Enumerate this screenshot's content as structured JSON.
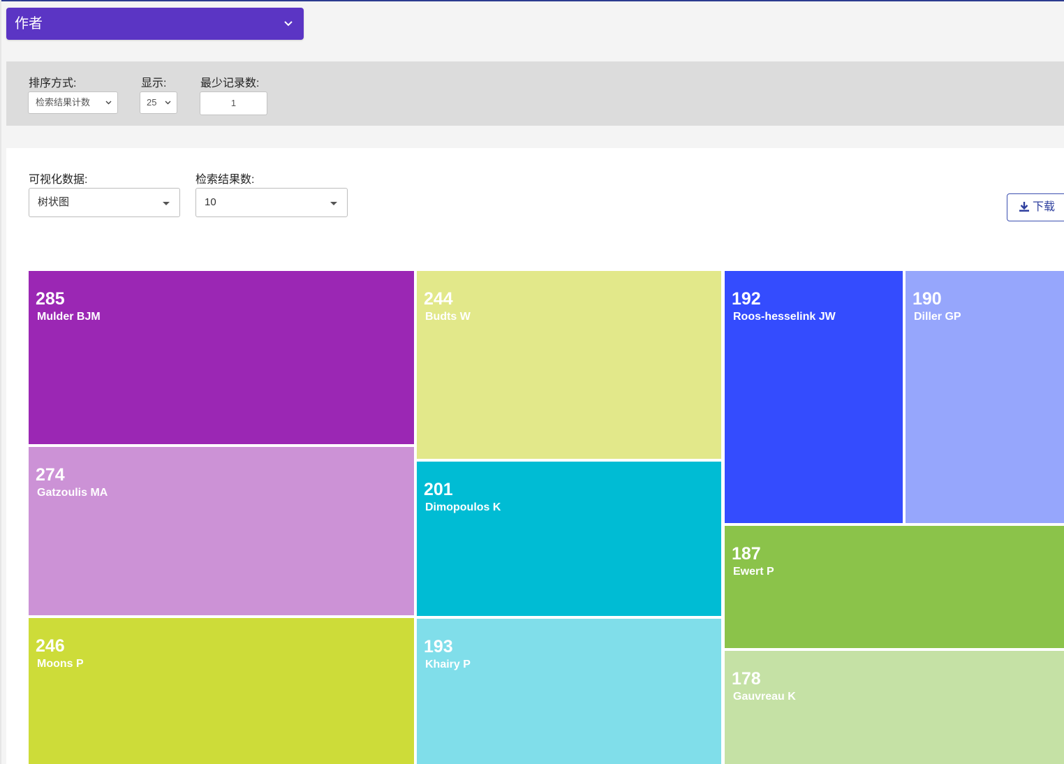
{
  "header": {
    "author_dropdown_label": "作者"
  },
  "filters": {
    "sort_label": "排序方式:",
    "sort_value": "检索结果计数",
    "show_label": "显示:",
    "show_value": "25",
    "min_records_label": "最少记录数:",
    "min_records_value": "1"
  },
  "visualization": {
    "data_label": "可视化数据:",
    "data_value": "树状图",
    "count_label": "检索结果数:",
    "count_value": "10",
    "download_label": "下载"
  },
  "chart_data": {
    "type": "treemap",
    "items": [
      {
        "name": "Mulder BJM",
        "value": 285,
        "color": "#9b27b4"
      },
      {
        "name": "Gatzoulis MA",
        "value": 274,
        "color": "#cc92d6"
      },
      {
        "name": "Moons P",
        "value": 246,
        "color": "#cddc39"
      },
      {
        "name": "Budts W",
        "value": 244,
        "color": "#e2e88a"
      },
      {
        "name": "Dimopoulos K",
        "value": 201,
        "color": "#00bcd4"
      },
      {
        "name": "Khairy P",
        "value": 193,
        "color": "#80deea"
      },
      {
        "name": "Roos-hesselink JW",
        "value": 192,
        "color": "#344cfe"
      },
      {
        "name": "Diller GP",
        "value": 190,
        "color": "#96a6fc"
      },
      {
        "name": "Ewert P",
        "value": 187,
        "color": "#8bc34a"
      },
      {
        "name": "Gauvreau K",
        "value": 178,
        "color": "#c5e1a5"
      }
    ]
  }
}
